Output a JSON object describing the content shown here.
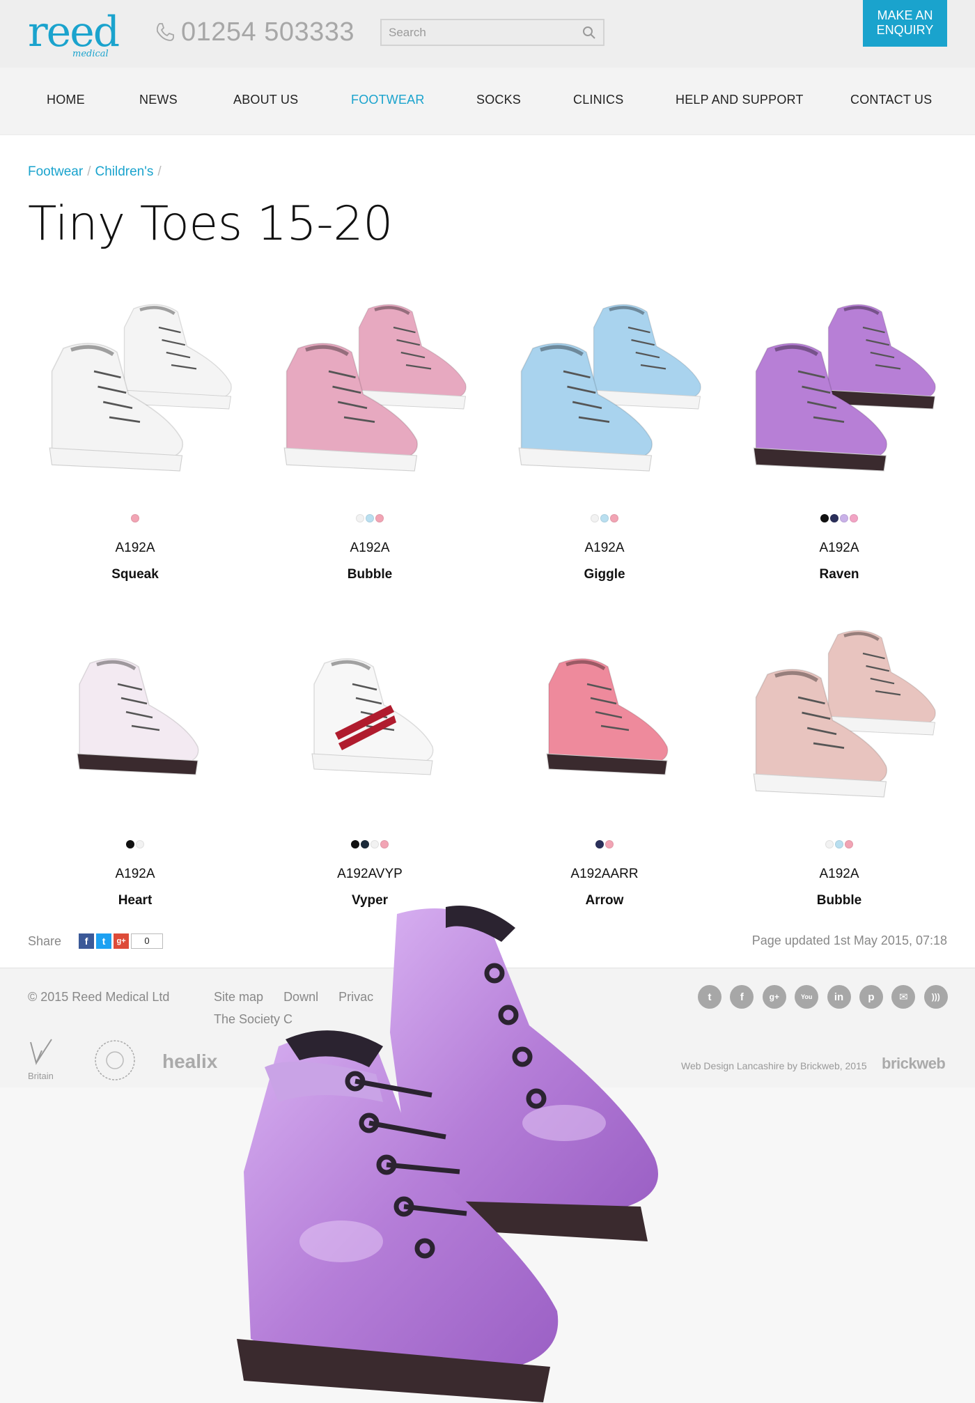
{
  "header": {
    "logo_text": "reed",
    "logo_sub": "medical",
    "phone": "01254 503333",
    "search_placeholder": "Search",
    "enquiry_line1": "MAKE AN",
    "enquiry_line2": "ENQUIRY"
  },
  "nav": [
    {
      "label": "HOME",
      "active": false
    },
    {
      "label": "NEWS",
      "active": false
    },
    {
      "label": "ABOUT US",
      "active": false
    },
    {
      "label": "FOOTWEAR",
      "active": true
    },
    {
      "label": "SOCKS",
      "active": false
    },
    {
      "label": "CLINICS",
      "active": false
    },
    {
      "label": "HELP AND SUPPORT",
      "active": false
    },
    {
      "label": "CONTACT US",
      "active": false
    }
  ],
  "breadcrumb": {
    "items": [
      "Footwear",
      "Children's"
    ],
    "separator": "/"
  },
  "page_title": "Tiny Toes 15-20",
  "products": [
    {
      "code": "A192A",
      "name": "Squeak",
      "colors": [
        "#f2a4b4"
      ],
      "shoe_color": "#f4f4f4",
      "icon": "white-bear-shoes"
    },
    {
      "code": "A192A",
      "name": "Bubble",
      "colors": [
        "#f2f2f2",
        "#b9dff0",
        "#f2a4b4"
      ],
      "shoe_color": "#e7a9c0",
      "icon": "pink-suede-shoes"
    },
    {
      "code": "A192A",
      "name": "Giggle",
      "colors": [
        "#f2f2f2",
        "#b9dff0",
        "#f2a4b4"
      ],
      "shoe_color": "#a9d3ee",
      "icon": "blue-bear-shoes"
    },
    {
      "code": "A192A",
      "name": "Raven",
      "colors": [
        "#111111",
        "#2a2f5a",
        "#c9b1e8",
        "#f2a4c4"
      ],
      "shoe_color": "#b77fd6",
      "icon": "purple-patent-shoes"
    },
    {
      "code": "A192A",
      "name": "Heart",
      "colors": [
        "#111111",
        "#f2f2f2"
      ],
      "shoe_color": "#f3eaf2",
      "icon": "white-heart-shoe"
    },
    {
      "code": "A192AVYP",
      "name": "Vyper",
      "colors": [
        "#111111",
        "#1b2a3a",
        "#f2f2f2",
        "#f2a4b4"
      ],
      "shoe_color": "#f7f7f7",
      "icon": "white-stripe-shoe"
    },
    {
      "code": "A192AARR",
      "name": "Arrow",
      "colors": [
        "#2a2f5a",
        "#f2a4b4"
      ],
      "shoe_color": "#ee8a9c",
      "icon": "pink-arrow-shoe"
    },
    {
      "code": "A192A",
      "name": "Bubble",
      "colors": [
        "#f2f2f2",
        "#b9dff0",
        "#f2a4b4"
      ],
      "shoe_color": "#e8c4bf",
      "icon": "pale-pink-shoes"
    }
  ],
  "share": {
    "label": "Share",
    "count": "0"
  },
  "updated": "Page updated 1st May 2015, 07:18",
  "footer": {
    "copyright": "© 2015  Reed Medical Ltd",
    "links": [
      "Site map",
      "Downl",
      "Privac"
    ],
    "links2": "The Society C",
    "logo_britain": "Britain",
    "logo_healix": "healix",
    "credit": "Web Design Lancashire by Brickweb, 2015",
    "brickweb": "brickweb"
  },
  "social": [
    "twitter-icon",
    "facebook-icon",
    "googleplus-icon",
    "youtube-icon",
    "linkedin-icon",
    "pinterest-icon",
    "email-icon",
    "rss-icon"
  ],
  "colors": {
    "accent": "#1aa3cd",
    "header_bg": "#eeeeee",
    "muted": "#888888"
  }
}
